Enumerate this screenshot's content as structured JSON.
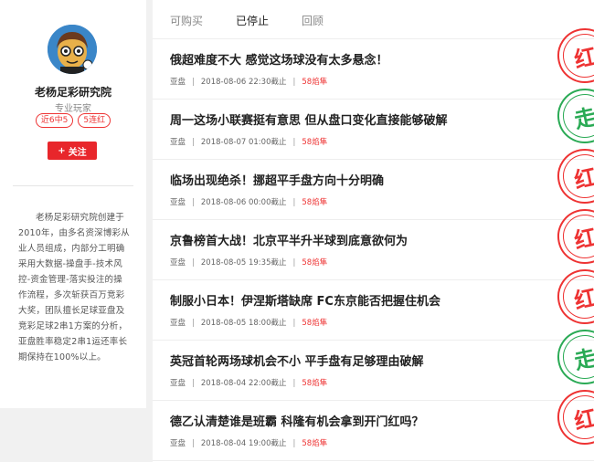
{
  "brand": {
    "logo_icon": "app-logo-icon"
  },
  "profile": {
    "name": "老杨足彩研究院",
    "role": "专业玩家",
    "tags": [
      "近6中5",
      "5连红"
    ],
    "follow_label": "关注",
    "bio": "老杨足彩研究院创建于2010年，由多名资深博彩从业人员组成，内部分工明确采用大数据-操盘手-技术风控-资金管理-落实投注的操作流程，多次斩获百万竞彩大奖，团队擅长足球亚盘及竞彩足球2串1方案的分析，亚盘胜率稳定2串1运还率长期保持在100%以上。"
  },
  "tabs": [
    {
      "label": "可购买",
      "active": false
    },
    {
      "label": "已停止",
      "active": true
    },
    {
      "label": "回顾",
      "active": false
    }
  ],
  "articles": [
    {
      "title": "俄超难度不大 感觉这场球没有太多悬念！",
      "category": "亚盘",
      "date": "2018-08-06 22:30截止",
      "hits": "58焰隼",
      "result": "红",
      "result_color": "#e33333"
    },
    {
      "title": "周一这场小联赛挺有意思 但从盘口变化直接能够破解",
      "category": "亚盘",
      "date": "2018-08-07 01:00截止",
      "hits": "58焰隼",
      "result": "走",
      "result_color": "#2aaa55"
    },
    {
      "title": "临场出现绝杀！挪超平手盘方向十分明确",
      "category": "亚盘",
      "date": "2018-08-06 00:00截止",
      "hits": "58焰隼",
      "result": "红",
      "result_color": "#e33333"
    },
    {
      "title": "京鲁榜首大战！北京平半升半球到底意欲何为",
      "category": "亚盘",
      "date": "2018-08-05 19:35截止",
      "hits": "58焰隼",
      "result": "红",
      "result_color": "#e33333"
    },
    {
      "title": "制服小日本！伊涅斯塔缺席 FC东京能否把握住机会",
      "category": "亚盘",
      "date": "2018-08-05 18:00截止",
      "hits": "58焰隼",
      "result": "红",
      "result_color": "#e33333"
    },
    {
      "title": "英冠首轮两场球机会不小 平手盘有足够理由破解",
      "category": "亚盘",
      "date": "2018-08-04 22:00截止",
      "hits": "58焰隼",
      "result": "走",
      "result_color": "#2aaa55"
    },
    {
      "title": "德乙认清楚谁是班霸 科隆有机会拿到开门红吗？",
      "category": "亚盘",
      "date": "2018-08-04 19:00截止",
      "hits": "58焰隼",
      "result": "红",
      "result_color": "#e33333"
    }
  ]
}
